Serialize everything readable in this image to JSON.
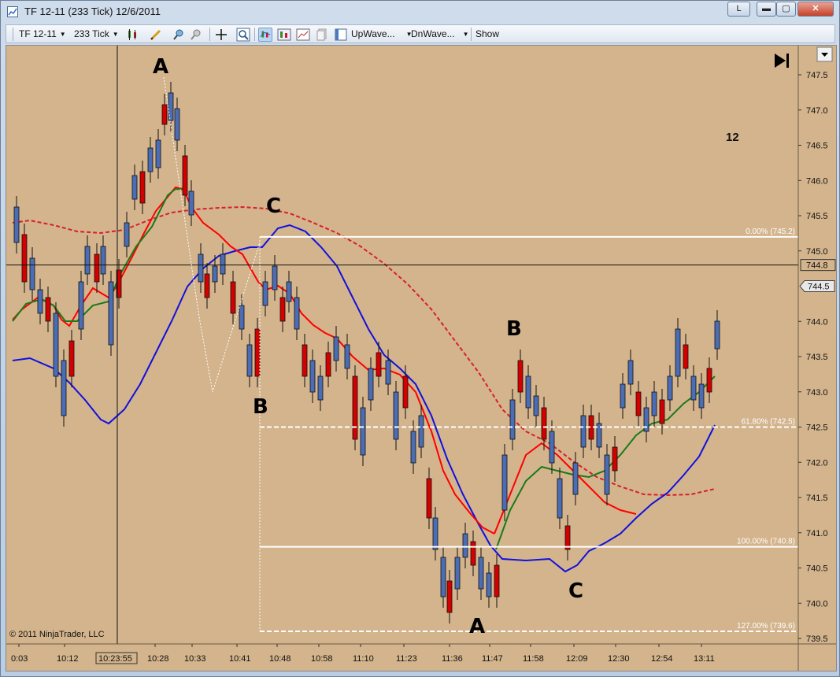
{
  "window": {
    "title": "TF 12-11 (233 Tick)  12/6/2011",
    "btn_l": "L",
    "btn_min": "▬",
    "btn_max": "▢",
    "btn_close": "✕"
  },
  "toolbar": {
    "instrument": "TF 12-11",
    "period": "233 Tick",
    "upwave": "UpWave...",
    "dnwave": "DnWave...",
    "show": "Show",
    "icons": [
      "bar-style-icon",
      "draw-tool-icon",
      "zoom-in-icon",
      "zoom-out-icon",
      "crosshair-icon",
      "magnifier-icon",
      "indicators-icon",
      "strategies-icon",
      "chart-properties-icon",
      "copy-icon",
      "templates-icon"
    ]
  },
  "chart": {
    "copyright": "© 2011 NinjaTrader, LLC",
    "counter": "12",
    "price_ticks": [
      "747.5",
      "747.0",
      "746.5",
      "746.0",
      "745.5",
      "745.0",
      "744.0",
      "743.5",
      "743.0",
      "742.5",
      "742.0",
      "741.5",
      "741.0",
      "740.5",
      "740.0",
      "739.5"
    ],
    "crosshair_price": "744.8",
    "last_price": "744.5",
    "time_ticks": [
      "0:03",
      "10:12",
      "10:28",
      "10:33",
      "10:41",
      "10:48",
      "10:58",
      "11:10",
      "11:23",
      "11:36",
      "11:47",
      "11:58",
      "12:09",
      "12:30",
      "12:54",
      "13:11"
    ],
    "crosshair_time": "10:23:55",
    "fib_levels": [
      {
        "label": "0.00% (745.2)"
      },
      {
        "label": "61.80% (742.5)"
      },
      {
        "label": "100.00% (740.8)"
      },
      {
        "label": "127.00% (739.6)"
      }
    ],
    "wave_labels": [
      "A",
      "C",
      "B",
      "B",
      "A",
      "C"
    ],
    "colors": {
      "background": "#d3b48c",
      "up_candle": "#4a6db5",
      "down_candle": "#d40000",
      "sma_red": "#ff0000",
      "sma_green": "#1a7a1a",
      "sma_blue": "#1010e0",
      "dash_red": "#d8202a",
      "fib": "#ffffff"
    }
  }
}
